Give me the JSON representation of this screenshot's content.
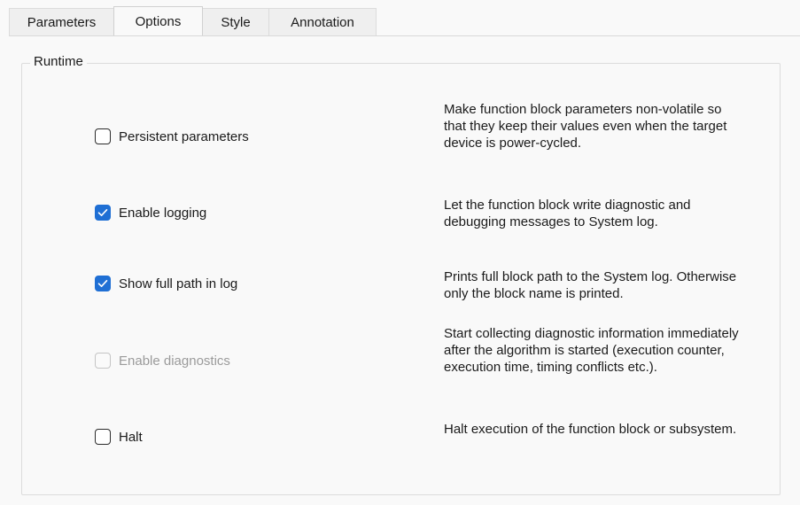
{
  "tabs": [
    {
      "label": "Parameters"
    },
    {
      "label": "Options"
    },
    {
      "label": "Style"
    },
    {
      "label": "Annotation"
    }
  ],
  "active_tab": "Options",
  "group": {
    "title": "Runtime"
  },
  "options": [
    {
      "label": "Persistent parameters",
      "checked": false,
      "enabled": true,
      "description": "Make function block parameters non-volatile so that they keep their values even when the target device is power-cycled."
    },
    {
      "label": "Enable logging",
      "checked": true,
      "enabled": true,
      "description": "Let the function block write diagnostic and debugging messages to System log."
    },
    {
      "label": "Show full path in log",
      "checked": true,
      "enabled": true,
      "description": "Prints full block path to the System log. Otherwise only the block name is printed."
    },
    {
      "label": "Enable diagnostics",
      "checked": false,
      "enabled": false,
      "description": "Start collecting diagnostic information immediately after the algorithm is started (execution counter, execution time, timing conflicts etc.)."
    },
    {
      "label": "Halt",
      "checked": false,
      "enabled": true,
      "description": "Halt execution of the function block or subsystem."
    }
  ],
  "colors": {
    "accent": "#1f6fd4",
    "disabled_text": "#9b9b9b",
    "background": "#f9f9f9"
  }
}
